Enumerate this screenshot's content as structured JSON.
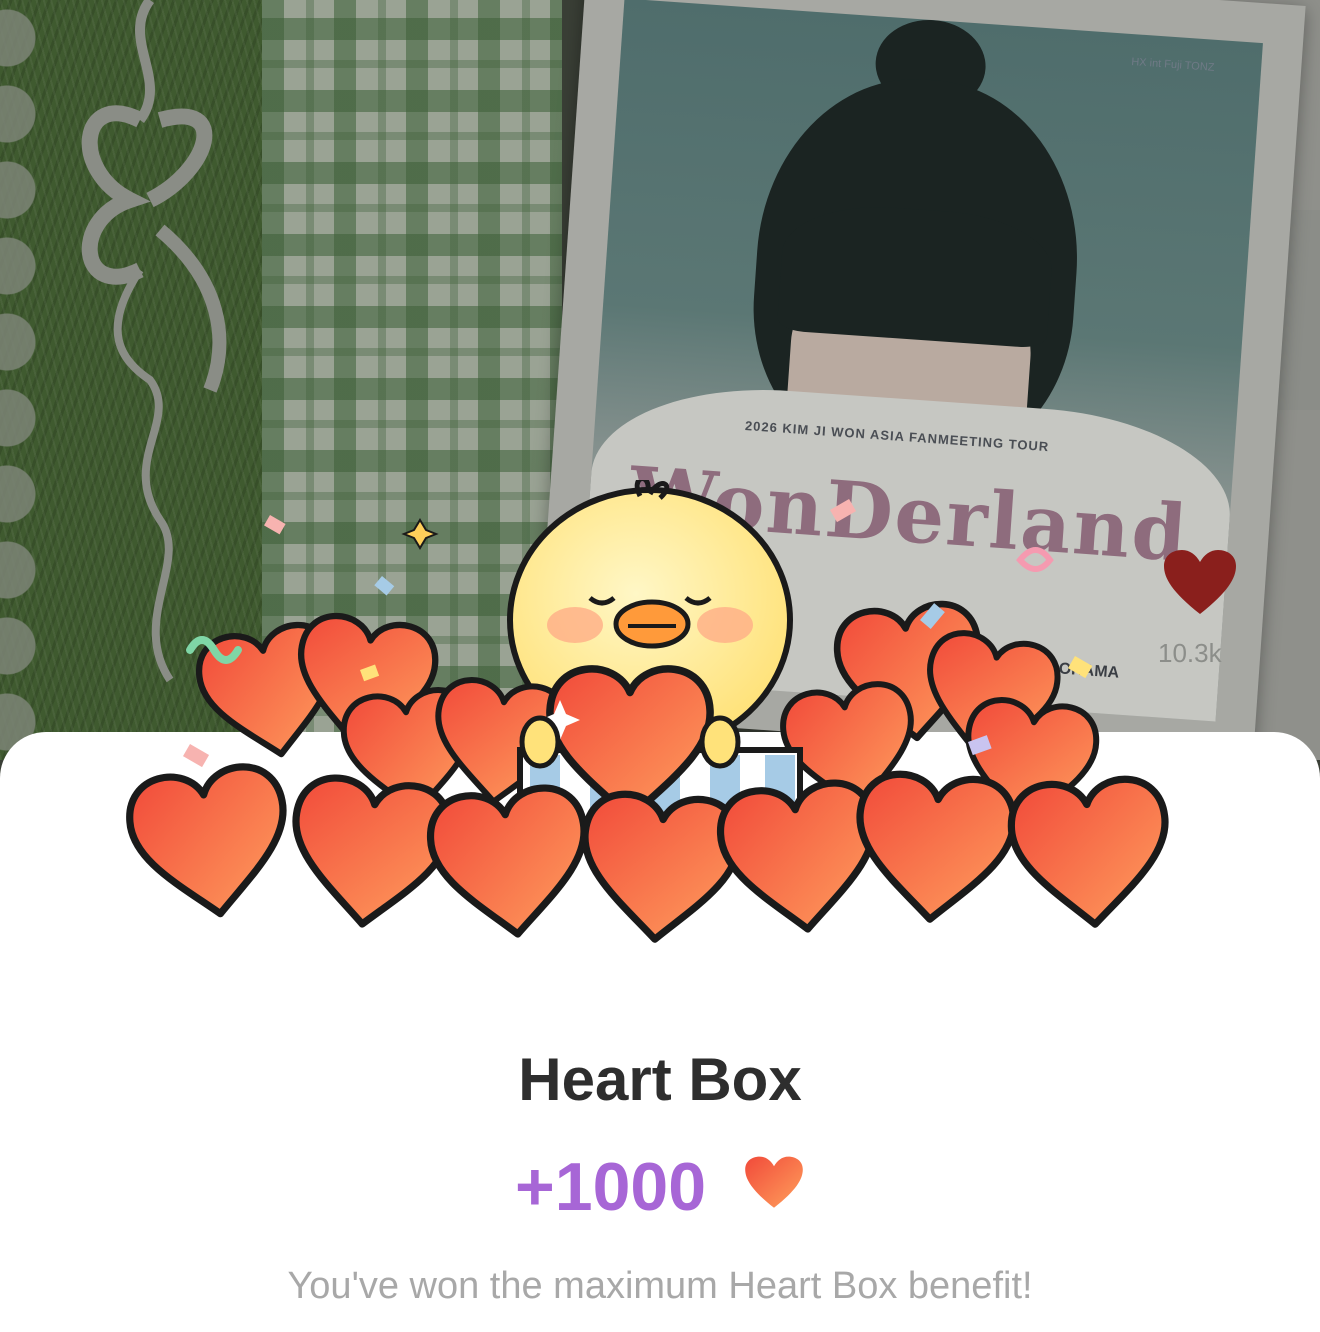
{
  "background": {
    "poster_tour_text": "2026 KIM JI WON ASIA FANMEETING TOUR",
    "poster_title_text": "WonDerland",
    "poster_city_text": "OHAMA",
    "poster_logos": "HX  int  Fuji  TONZ",
    "like_count": "10.3k"
  },
  "sheet": {
    "title": "Heart Box",
    "reward_amount": "+1000",
    "message": "You've won the maximum Heart Box benefit!"
  },
  "colors": {
    "reward_purple": "#a766d6",
    "heart_red": "#f04f3c",
    "heart_orange": "#ff9a5c",
    "title_dark": "#2e2e2e",
    "message_gray": "#a8a8a8"
  },
  "icons": {
    "mascot": "yellow-chick-holding-heart",
    "reward": "heart-icon",
    "like": "heart-icon"
  }
}
